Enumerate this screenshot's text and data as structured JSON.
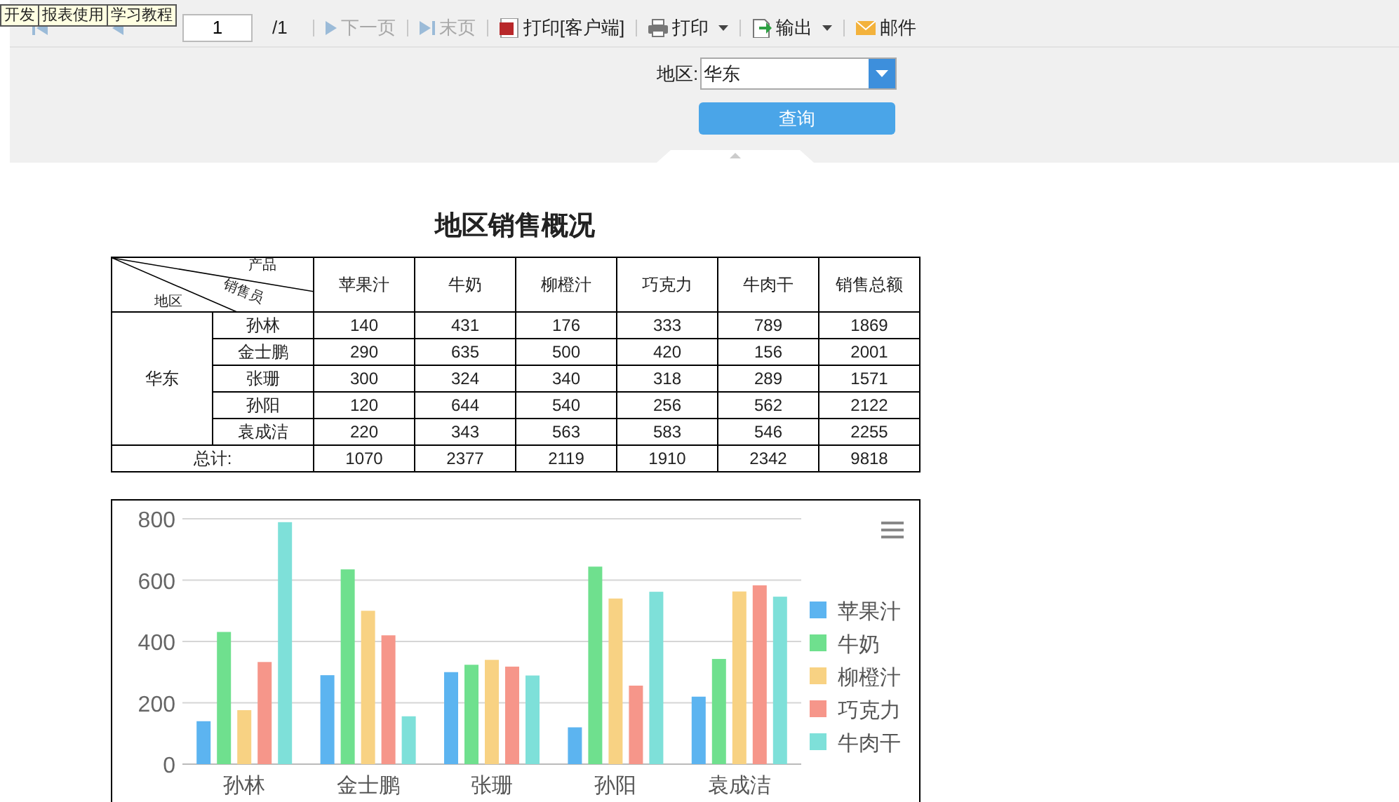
{
  "tooltip": {
    "items": [
      "开发",
      "报表使用",
      "学习教程"
    ]
  },
  "toolbar": {
    "nav_before": [
      {
        "kind": "first",
        "disabled": true
      },
      {
        "kind": "prev",
        "disabled": true
      }
    ],
    "page_field": {
      "value": "1"
    },
    "page_count": "/1",
    "buttons": [
      {
        "label": "下一页",
        "kind": "next",
        "disabled": true,
        "dropdown": false
      },
      {
        "label": "末页",
        "kind": "last",
        "disabled": true,
        "dropdown": false
      },
      {
        "label": "打印[客户端]",
        "kind": "client-print",
        "disabled": false,
        "dropdown": false
      },
      {
        "label": "打印",
        "kind": "print",
        "disabled": false,
        "dropdown": true
      },
      {
        "label": "输出",
        "kind": "export",
        "disabled": false,
        "dropdown": true
      },
      {
        "label": "邮件",
        "kind": "mail",
        "disabled": false,
        "dropdown": false
      }
    ]
  },
  "filter": {
    "label": "地区:",
    "value": "华东",
    "button": "查询"
  },
  "report": {
    "title": "地区销售概况",
    "corner": {
      "top": "产品",
      "middle": "销售员",
      "bottom": "地区"
    },
    "columns": [
      "苹果汁",
      "牛奶",
      "柳橙汁",
      "巧克力",
      "牛肉干",
      "销售总额"
    ],
    "group": "华东",
    "rows": [
      {
        "name": "孙林",
        "values": [
          "140",
          "431",
          "176",
          "333",
          "789",
          "1869"
        ]
      },
      {
        "name": "金士鹏",
        "values": [
          "290",
          "635",
          "500",
          "420",
          "156",
          "2001"
        ]
      },
      {
        "name": "张珊",
        "values": [
          "300",
          "324",
          "340",
          "318",
          "289",
          "1571"
        ]
      },
      {
        "name": "孙阳",
        "values": [
          "120",
          "644",
          "540",
          "256",
          "562",
          "2122"
        ]
      },
      {
        "name": "袁成洁",
        "values": [
          "220",
          "343",
          "563",
          "583",
          "546",
          "2255"
        ]
      }
    ],
    "total": {
      "label": "总计:",
      "values": [
        "1070",
        "2377",
        "2119",
        "1910",
        "2342",
        "9818"
      ]
    }
  },
  "chart": {
    "chart_data": {
      "type": "bar",
      "categories": [
        "孙林",
        "金士鹏",
        "张珊",
        "孙阳",
        "袁成洁"
      ],
      "series": [
        {
          "name": "苹果汁",
          "color": "#5cb4f0",
          "values": [
            140,
            290,
            300,
            120,
            220
          ]
        },
        {
          "name": "牛奶",
          "color": "#6fe08e",
          "values": [
            431,
            635,
            324,
            644,
            343
          ]
        },
        {
          "name": "柳橙汁",
          "color": "#f8d283",
          "values": [
            176,
            500,
            340,
            540,
            563
          ]
        },
        {
          "name": "巧克力",
          "color": "#f6968a",
          "values": [
            333,
            420,
            318,
            256,
            583
          ]
        },
        {
          "name": "牛肉干",
          "color": "#7ee0d9",
          "values": [
            789,
            156,
            289,
            562,
            546
          ]
        }
      ],
      "ylim": [
        0,
        800
      ],
      "yticks": [
        0,
        200,
        400,
        600,
        800
      ],
      "grid": true,
      "legend": true
    }
  }
}
